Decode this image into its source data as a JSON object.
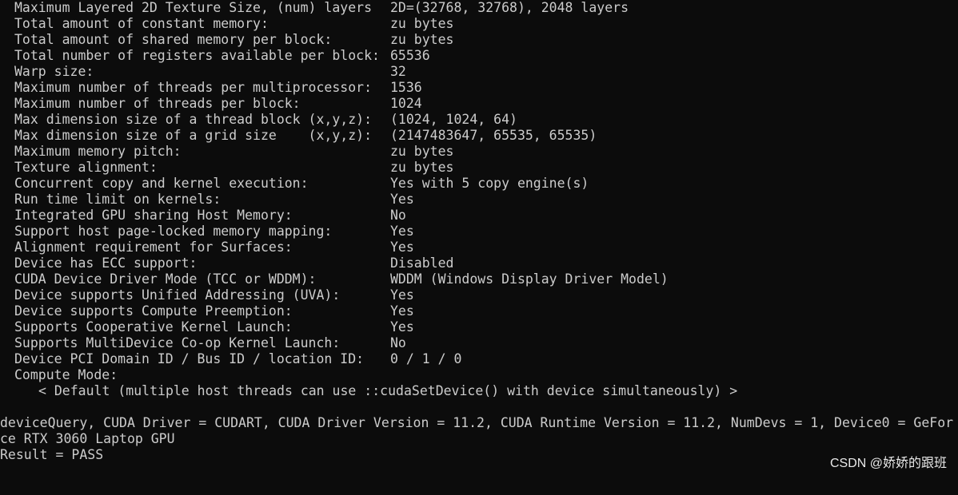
{
  "device_properties": [
    {
      "label": "Maximum Layered 2D Texture Size, (num) layers",
      "value": "2D=(32768, 32768), 2048 layers"
    },
    {
      "label": "Total amount of constant memory:",
      "value": "zu bytes"
    },
    {
      "label": "Total amount of shared memory per block:",
      "value": "zu bytes"
    },
    {
      "label": "Total number of registers available per block:",
      "value": "65536"
    },
    {
      "label": "Warp size:",
      "value": "32"
    },
    {
      "label": "Maximum number of threads per multiprocessor:",
      "value": "1536"
    },
    {
      "label": "Maximum number of threads per block:",
      "value": "1024"
    },
    {
      "label": "Max dimension size of a thread block (x,y,z):",
      "value": "(1024, 1024, 64)"
    },
    {
      "label": "Max dimension size of a grid size    (x,y,z):",
      "value": "(2147483647, 65535, 65535)"
    },
    {
      "label": "Maximum memory pitch:",
      "value": "zu bytes"
    },
    {
      "label": "Texture alignment:",
      "value": "zu bytes"
    },
    {
      "label": "Concurrent copy and kernel execution:",
      "value": "Yes with 5 copy engine(s)"
    },
    {
      "label": "Run time limit on kernels:",
      "value": "Yes"
    },
    {
      "label": "Integrated GPU sharing Host Memory:",
      "value": "No"
    },
    {
      "label": "Support host page-locked memory mapping:",
      "value": "Yes"
    },
    {
      "label": "Alignment requirement for Surfaces:",
      "value": "Yes"
    },
    {
      "label": "Device has ECC support:",
      "value": "Disabled"
    },
    {
      "label": "CUDA Device Driver Mode (TCC or WDDM):",
      "value": "WDDM (Windows Display Driver Model)"
    },
    {
      "label": "Device supports Unified Addressing (UVA):",
      "value": "Yes"
    },
    {
      "label": "Device supports Compute Preemption:",
      "value": "Yes"
    },
    {
      "label": "Supports Cooperative Kernel Launch:",
      "value": "Yes"
    },
    {
      "label": "Supports MultiDevice Co-op Kernel Launch:",
      "value": "No"
    },
    {
      "label": "Device PCI Domain ID / Bus ID / location ID:",
      "value": "0 / 1 / 0"
    },
    {
      "label": "Compute Mode:",
      "value": ""
    }
  ],
  "compute_mode_detail": "< Default (multiple host threads can use ::cudaSetDevice() with device simultaneously) >",
  "summary_lines": [
    "deviceQuery, CUDA Driver = CUDART, CUDA Driver Version = 11.2, CUDA Runtime Version = 11.2, NumDevs = 1, Device0 = GeFor",
    "ce RTX 3060 Laptop GPU",
    "Result = PASS"
  ],
  "watermark": "CSDN @娇娇的跟班",
  "colors": {
    "background": "#0c0c0c",
    "text": "#cccccc",
    "watermark": "#e8e8e8"
  }
}
